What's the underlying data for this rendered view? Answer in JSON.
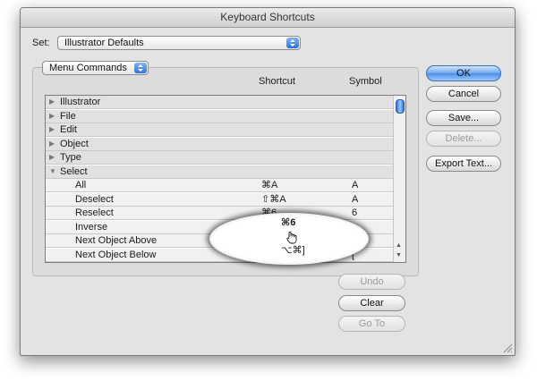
{
  "window": {
    "title": "Keyboard Shortcuts"
  },
  "set": {
    "label": "Set:",
    "value": "Illustrator Defaults"
  },
  "commands_popup": {
    "value": "Menu Commands"
  },
  "columns": {
    "shortcut": "Shortcut",
    "symbol": "Symbol"
  },
  "groups": [
    {
      "name": "Illustrator",
      "expanded": false
    },
    {
      "name": "File",
      "expanded": false
    },
    {
      "name": "Edit",
      "expanded": false
    },
    {
      "name": "Object",
      "expanded": false
    },
    {
      "name": "Type",
      "expanded": false
    },
    {
      "name": "Select",
      "expanded": true
    }
  ],
  "commands": [
    {
      "name": "All",
      "shortcut": "⌘A",
      "symbol": "A"
    },
    {
      "name": "Deselect",
      "shortcut": "⇧⌘A",
      "symbol": "A"
    },
    {
      "name": "Reselect",
      "shortcut": "⌘6",
      "symbol": "6"
    },
    {
      "name": "Inverse",
      "shortcut": "",
      "symbol": ""
    },
    {
      "name": "Next Object Above",
      "shortcut": "⌥⌘]",
      "symbol": "]"
    },
    {
      "name": "Next Object Below",
      "shortcut": "⌥⌘[",
      "symbol": "["
    }
  ],
  "buttons": {
    "ok": "OK",
    "cancel": "Cancel",
    "save": "Save...",
    "delete": "Delete...",
    "export": "Export Text...",
    "undo": "Undo",
    "clear": "Clear",
    "goto": "Go To"
  },
  "colors": {
    "accent": "#4d8fe6",
    "dialog_bg": "#e3e3e3"
  }
}
